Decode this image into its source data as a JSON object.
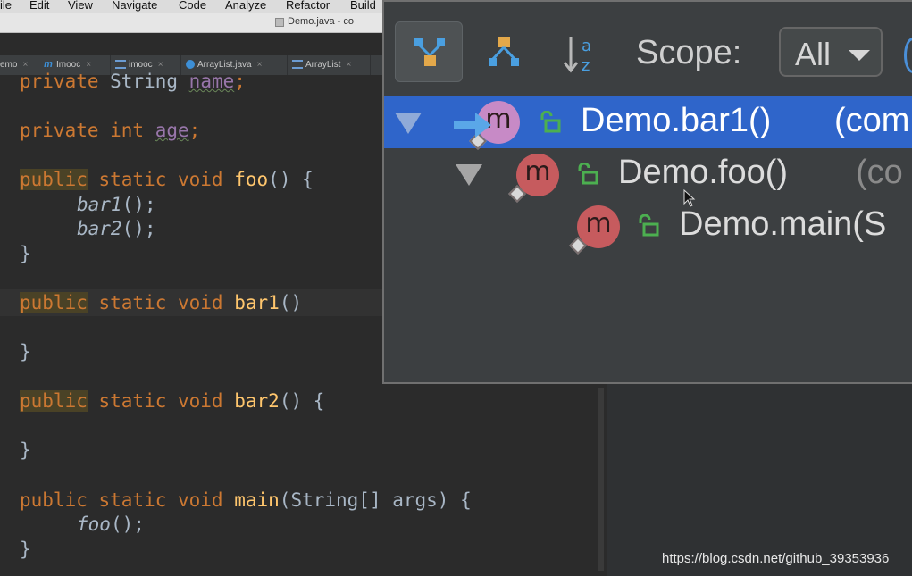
{
  "menu": [
    "ile",
    "Edit",
    "View",
    "Navigate",
    "Code",
    "Analyze",
    "Refactor",
    "Build"
  ],
  "window_title": "Demo.java - co",
  "tabs": [
    {
      "label": "emo",
      "icon": "none"
    },
    {
      "label": "Imooc",
      "icon": "method-m-icon"
    },
    {
      "label": "imooc",
      "icon": "module-icon"
    },
    {
      "label": "ArrayList.java",
      "icon": "class-icon"
    },
    {
      "label": "ArrayList",
      "icon": "module-icon"
    }
  ],
  "code": {
    "l1_kw": "private ",
    "l1_type": "String ",
    "l1_field": "name",
    "l1_end": ";",
    "l2_kw": "private int ",
    "l2_field": "age",
    "l2_end": ";",
    "l3_kw1": "public",
    "l3_kw2": " static void ",
    "l3_fn": "foo",
    "l3_end": "() {",
    "l4_call": "bar1",
    "l4_end": "();",
    "l5_call": "bar2",
    "l5_end": "();",
    "brace": "}",
    "l7_kw1": "public",
    "l7_kw2": " static void ",
    "l7_fn": "bar1",
    "l7_end": "()",
    "l10_kw1": "public",
    "l10_kw2": " static void ",
    "l10_fn": "bar2",
    "l10_end": "() {",
    "l13_kw": "public static void ",
    "l13_fn": "main",
    "l13_end": "(String[] args) {",
    "l14_call": "foo",
    "l14_end": "();"
  },
  "popup": {
    "scope_label": "Scope:",
    "scope_value": "All",
    "tree": [
      {
        "name": "Demo.bar1()",
        "context": "(com",
        "selected": true
      },
      {
        "name": "Demo.foo()",
        "context": "(co",
        "selected": false
      },
      {
        "name": "Demo.main(S",
        "context": "",
        "selected": false
      }
    ]
  },
  "watermark": "https://blog.csdn.net/github_39353936",
  "colors": {
    "keyword": "#cc7832",
    "function": "#ffc66d",
    "selection": "#2f65ca",
    "method_icon": "#c65b5e"
  }
}
